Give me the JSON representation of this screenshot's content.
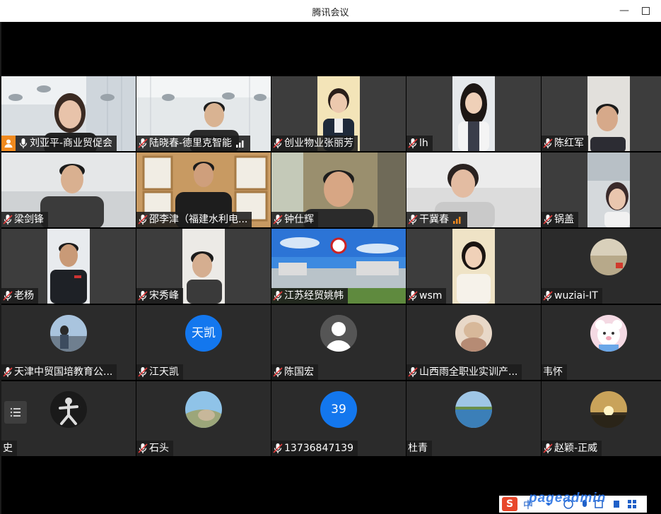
{
  "window": {
    "title": "腾讯会议"
  },
  "participants": [
    {
      "name": "刘亚平-商业贸促会",
      "video": true
    },
    {
      "name": "陆晓春-德里克智能",
      "video": true
    },
    {
      "name": "创业物业张丽芳",
      "video": true
    },
    {
      "name": "lh",
      "video": true
    },
    {
      "name": "陈红军",
      "video": true
    },
    {
      "name": "梁剑锋",
      "video": true
    },
    {
      "name": "邵李津（福建水利电...",
      "video": true
    },
    {
      "name": "钟仕辉",
      "video": true
    },
    {
      "name": "干冀春",
      "video": true
    },
    {
      "name": "锅盖",
      "video": true
    },
    {
      "name": "老杨",
      "video": true
    },
    {
      "name": "宋秀峰",
      "video": true
    },
    {
      "name": "江苏经贸姚帏",
      "video": true
    },
    {
      "name": "wsm",
      "video": true
    },
    {
      "name": "wuziai-IT",
      "video": false
    },
    {
      "name": "天津中贸国培教育公...",
      "video": false
    },
    {
      "name": "江天凯",
      "video": false,
      "avatar_text": "天凯"
    },
    {
      "name": "陈国宏",
      "video": false
    },
    {
      "name": "山西雨全职业实训产...",
      "video": false
    },
    {
      "name": "韦怀",
      "video": false
    },
    {
      "name": "史",
      "video": false
    },
    {
      "name": "石头",
      "video": false
    },
    {
      "name": "13736847139",
      "video": false,
      "avatar_text": "39"
    },
    {
      "name": "杜青",
      "video": false
    },
    {
      "name": "赵颖-正威",
      "video": false
    }
  ],
  "taskbar": {
    "ime_logo": "S",
    "ime_lang": "中"
  },
  "watermark": "pageadmin",
  "colors": {
    "host_badge": "#f08a1f",
    "active_speaker": "#2db24a",
    "avatar_blue": "#1377ee",
    "signal": "#f08a1f"
  }
}
